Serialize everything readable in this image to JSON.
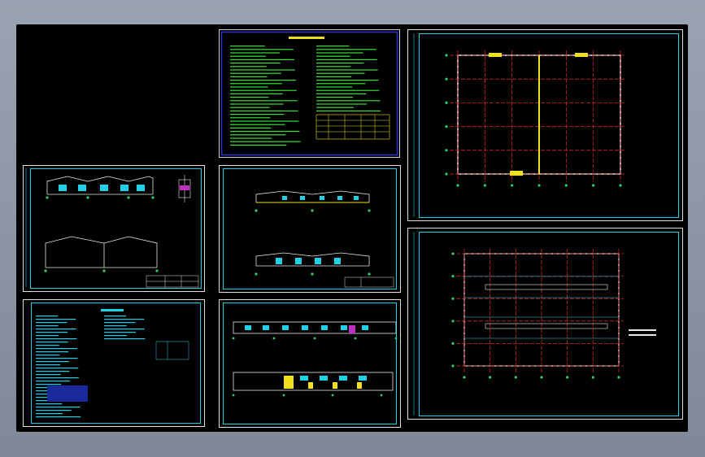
{
  "app": {
    "background_color": "#8f98a6",
    "canvas_color": "#000000"
  },
  "colors": {
    "frame_cyan": "#1fd0e6",
    "grid_red": "#d02626",
    "building_white": "#e8e8e8",
    "node_green": "#2fd06a",
    "highlight_yellow": "#f0e020",
    "notes_blue_border": "#3030d0",
    "notes_text_green": "#38e038"
  },
  "sheets": [
    {
      "id": "notes-sheet-general",
      "kind": "text-notes",
      "title": ""
    },
    {
      "id": "elevation-sheet-1",
      "kind": "elevations"
    },
    {
      "id": "elevation-sheet-2",
      "kind": "elevations"
    },
    {
      "id": "elevation-sheet-3",
      "kind": "elevations"
    },
    {
      "id": "design-notes-sheet",
      "kind": "text-notes"
    },
    {
      "id": "plan-sheet-column-grid",
      "kind": "floor-plan"
    },
    {
      "id": "plan-sheet-roof-layout",
      "kind": "floor-plan"
    }
  ]
}
